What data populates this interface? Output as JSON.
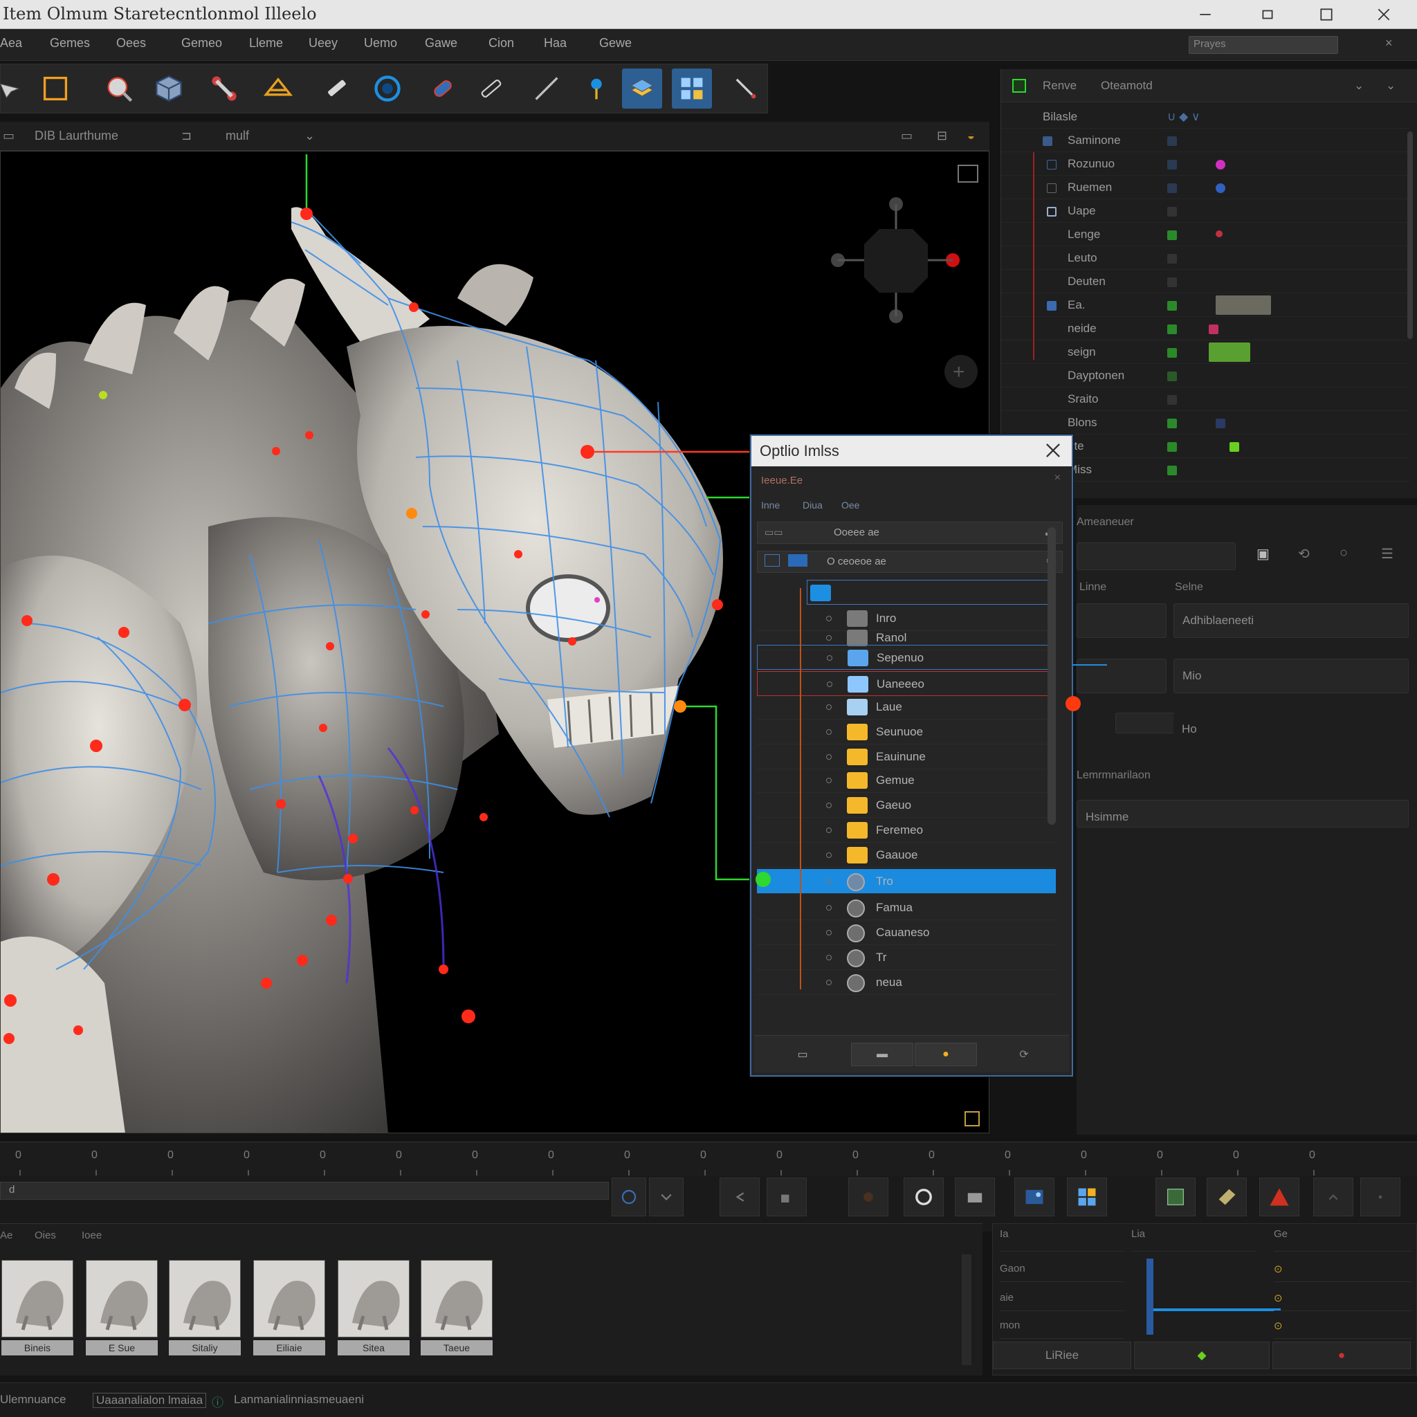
{
  "window": {
    "title": "Item Olmum Staretecntlonmol Illeelo"
  },
  "menu": {
    "items": [
      "Aea",
      "Gemes",
      "Oees",
      "Gemeo",
      "Lleme",
      "Ueey",
      "Uemo",
      "Gawe",
      "Cion",
      "Haa",
      "Gewe"
    ],
    "search_placeholder": "Prayes"
  },
  "viewport_header": {
    "crumb1": "DIB Laurthume",
    "crumb2": "mulf"
  },
  "outliner": {
    "header_a": "Renve",
    "header_b": "Oteamotd",
    "root": "Bilasle",
    "rows": [
      {
        "label": "Saminone",
        "dot": ""
      },
      {
        "label": "Rozunuo",
        "dot": "#d030c0"
      },
      {
        "label": "Ruemen",
        "dot": "#3060c0"
      },
      {
        "label": "Uape",
        "dot": ""
      },
      {
        "label": "Lenge",
        "dot": "#c03040"
      },
      {
        "label": "Leuto",
        "dot": ""
      },
      {
        "label": "Deuten",
        "dot": ""
      },
      {
        "label": "Ea.",
        "dot": ""
      },
      {
        "label": "neide",
        "dot": ""
      },
      {
        "label": "seign",
        "dot": ""
      },
      {
        "label": "Dayptonen",
        "dot": ""
      },
      {
        "label": "Sraito",
        "dot": ""
      },
      {
        "label": "Blons",
        "dot": ""
      },
      {
        "label": "nte",
        "dot": ""
      },
      {
        "label": "Miss",
        "dot": ""
      }
    ]
  },
  "attributes": {
    "section_title": "Ameaneuer",
    "col_a": "Linne",
    "col_b": "Selne",
    "field1": "Adhiblaeneeti",
    "field2": "Mio",
    "field3": "Ho",
    "sub_a": "Lemrmnarilaon",
    "sub_b": "Hsimme"
  },
  "dialog": {
    "title": "Optlio Imlss",
    "subtitle": "Ieeue.Ee",
    "tabs": [
      "Inne",
      "Diua",
      "Oee"
    ],
    "bar_text": "Ooeee ae",
    "path_text": "O ceoeoe ae",
    "rows": [
      {
        "label": "",
        "icon": "#1d8fe2",
        "state": "path"
      },
      {
        "label": "Inro",
        "icon": "#7a7a7a",
        "state": ""
      },
      {
        "label": "Ranol",
        "icon": "#7a7a7a",
        "state": ""
      },
      {
        "label": "Sepenuo",
        "icon": "#5aa5ee",
        "state": "hl"
      },
      {
        "label": "Uaneeeo",
        "icon": "#8ec7ff",
        "state": "hl-red"
      },
      {
        "label": "Laue",
        "icon": "#a8d0f0",
        "state": ""
      },
      {
        "label": "Seunuoe",
        "icon": "#f5b82a",
        "state": ""
      },
      {
        "label": "Eauinune",
        "icon": "#f5b82a",
        "state": ""
      },
      {
        "label": "Gemue",
        "icon": "#f5b82a",
        "state": ""
      },
      {
        "label": "Gaeuo",
        "icon": "#f5b82a",
        "state": ""
      },
      {
        "label": "Feremeo",
        "icon": "#f5b82a",
        "state": ""
      },
      {
        "label": "Gaauoe",
        "icon": "#f5b82a",
        "state": ""
      },
      {
        "label": "Tro",
        "icon": "#6e8aa6",
        "state": "sel"
      },
      {
        "label": "Famua",
        "icon": "#6e6e6e",
        "state": ""
      },
      {
        "label": "Cauaneso",
        "icon": "#6e6e6e",
        "state": ""
      },
      {
        "label": "Tr",
        "icon": "#6e6e6e",
        "state": ""
      },
      {
        "label": "neua",
        "icon": "#6e6e6e",
        "state": ""
      }
    ]
  },
  "timeline": {
    "ticks": [
      "0",
      "0",
      "0",
      "0",
      "0",
      "0",
      "0",
      "0",
      "0",
      "0",
      "0",
      "0",
      "0",
      "0",
      "0",
      "0",
      "0",
      "0"
    ],
    "scrub_label": "d"
  },
  "assets": {
    "tabs": [
      "Ae",
      "Oies",
      "Ioee"
    ],
    "items": [
      "Bineis",
      "E Sue",
      "Sitaliy",
      "Eiliaie",
      "Sitea",
      "Taeue"
    ]
  },
  "bottom_right": {
    "headers": [
      "Ia",
      "Lia",
      "Ge"
    ],
    "rows": [
      "Gaon",
      "aie",
      "mon"
    ],
    "apply_label": "LiRiee"
  },
  "status": {
    "left": "Ulemnuance",
    "mid": "Uaaanalialon lmaiaa",
    "right": "Lanmanialinniasmeuaeni"
  },
  "colors": {
    "accent_blue": "#1d8fe2",
    "folder_yellow": "#f5b82a",
    "joint_red": "#ff2a1a",
    "guide_green": "#2ed82e",
    "wire_blue": "#3d8fe8"
  }
}
